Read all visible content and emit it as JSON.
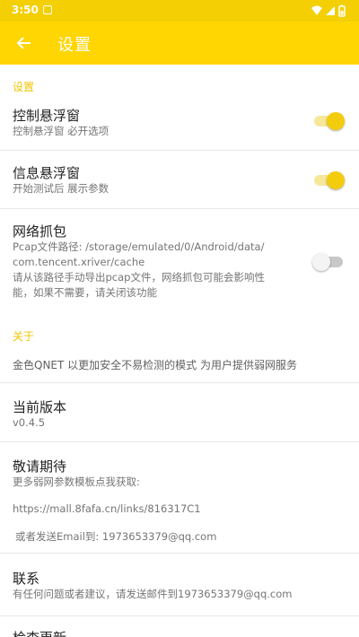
{
  "status_bar": {
    "time": "3:50",
    "icons": [
      "notification-icon",
      "wifi-icon",
      "signal-icon",
      "battery-icon"
    ]
  },
  "app_bar": {
    "back_icon": "arrow-back-icon",
    "title": "设置"
  },
  "colors": {
    "accent": "#ffd502",
    "status_bar": "#f3cf03",
    "category_text": "#f0c400"
  },
  "settings": {
    "category_label": "设置",
    "float_window": {
      "title": "控制悬浮窗",
      "summary": "控制悬浮窗 必开选项",
      "enabled": true
    },
    "info_window": {
      "title": "信息悬浮窗",
      "summary": "开始测试后 展示参数",
      "enabled": true
    },
    "packet_capture": {
      "title": "网络抓包",
      "summary_line1": "Pcap文件路径: /storage/emulated/0/Android/data/",
      "summary_line2": "com.tencent.xriver/cache",
      "summary_line3": "请从该路径手动导出pcap文件，网络抓包可能会影响性",
      "summary_line4": "能，如果不需要，请关闭该功能",
      "enabled": false
    }
  },
  "about": {
    "category_label": "关于",
    "description": "金色QNET 以更加安全不易检测的模式 为用户提供弱网服务",
    "version": {
      "title": "当前版本",
      "value": "v0.4.5"
    },
    "coming_soon": {
      "title": "敬请期待",
      "summary": "更多弱网参数模板点我获取:",
      "link": "https://mall.8fafa.cn/links/816317C1",
      "email_note": "或者发送Email到: 1973653379@qq.com"
    },
    "contact": {
      "title": "联系",
      "summary": "有任何问题或者建议，请发送邮件到1973653379@qq.com"
    },
    "check_update": {
      "title": "检查更新"
    }
  }
}
